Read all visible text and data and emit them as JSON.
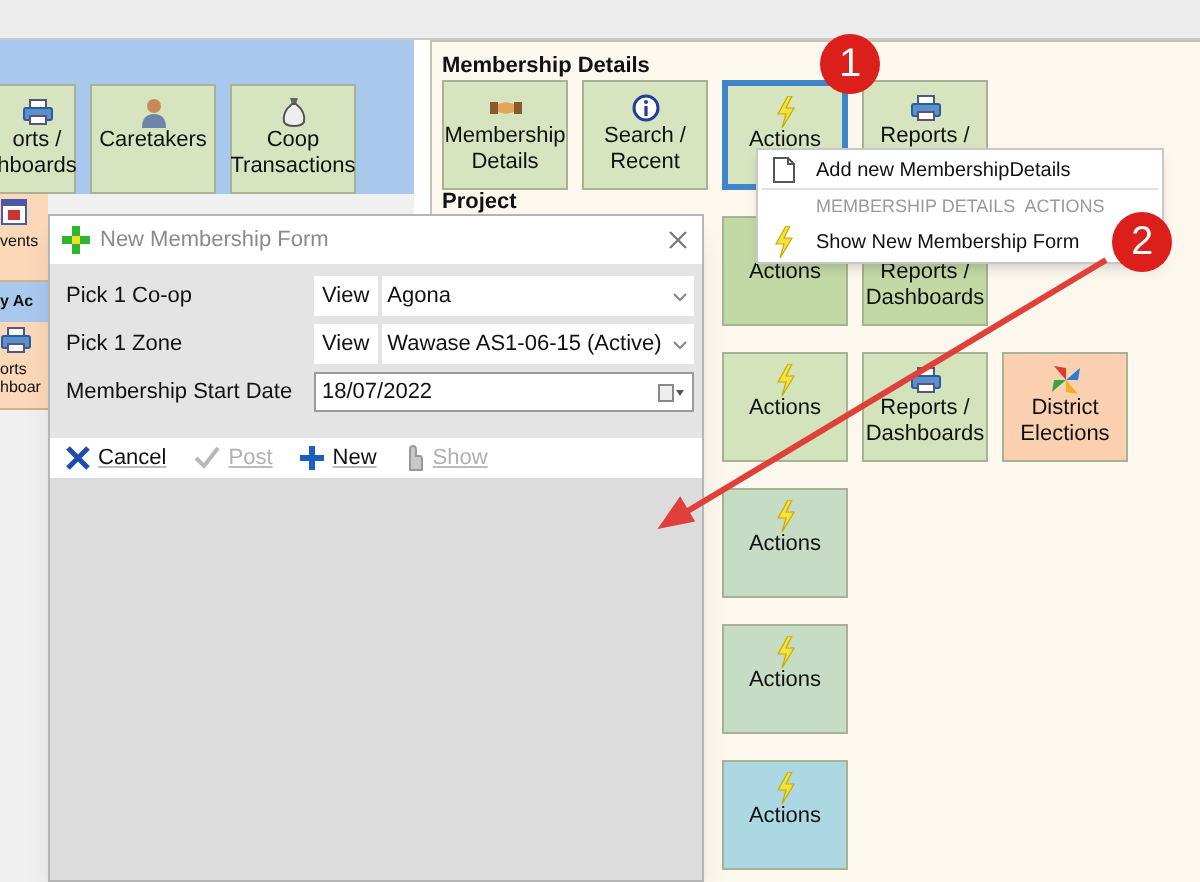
{
  "left_panel": {
    "tiles": [
      {
        "label": "orts /\nhboards",
        "kind": "printer",
        "color": "#d6e4c0"
      },
      {
        "label": "Caretakers",
        "kind": "person",
        "color": "#d6e4c0"
      },
      {
        "label": "Coop\nTransactions",
        "kind": "moneybag",
        "color": "#d6e4c0"
      }
    ]
  },
  "left_strip": {
    "items": [
      {
        "kind": "calendar",
        "label": "vents"
      },
      {
        "kind": "heading",
        "label": "y Ac"
      },
      {
        "kind": "printer",
        "label": "orts\nhboar"
      }
    ]
  },
  "right_panel": {
    "sections": [
      {
        "title": "Membership Details",
        "tiles": [
          {
            "label": "Membership\nDetails",
            "kind": "handshake",
            "color": "#d6e4c0",
            "selected": false
          },
          {
            "label": "Search /\nRecent",
            "kind": "info",
            "color": "#d6e4c0",
            "selected": false
          },
          {
            "label": "Actions",
            "kind": "lightning",
            "color": "#d6e4c0",
            "selected": true
          },
          {
            "label": "Reports /",
            "kind": "printer",
            "color": "#d6e4c0",
            "selected": false
          }
        ]
      },
      {
        "title": "Project",
        "tiles": [
          {
            "label": "Actions",
            "kind": "plain",
            "color": "#c3d9a5",
            "selected": false
          },
          {
            "label": "Reports /\nDashboards",
            "kind": "plain",
            "color": "#c3d9a5",
            "selected": false
          }
        ]
      },
      {
        "tiles": [
          {
            "label": "Actions",
            "kind": "lightning",
            "color": "#d3e3bb",
            "selected": false
          },
          {
            "label": "Reports /\nDashboards",
            "kind": "printer",
            "color": "#d3e3bb",
            "selected": false
          },
          {
            "label": "District\nElections",
            "kind": "pinwheel",
            "color": "#fbd0b0",
            "selected": false
          }
        ]
      },
      {
        "tiles": [
          {
            "label": "Actions",
            "kind": "lightning",
            "color": "#c6dcc4",
            "selected": false
          }
        ]
      },
      {
        "tiles": [
          {
            "label": "Actions",
            "kind": "lightning",
            "color": "#c6dcc4",
            "selected": false
          }
        ]
      },
      {
        "tiles": [
          {
            "label": "Actions",
            "kind": "lightning",
            "color": "#acd8e4",
            "selected": false
          }
        ]
      }
    ]
  },
  "dialog": {
    "title": "New Membership Form",
    "fields": [
      {
        "kind": "combo",
        "label": "Pick 1 Co-op",
        "button": "View",
        "value": "Agona"
      },
      {
        "kind": "combo",
        "label": "Pick 1 Zone",
        "button": "View",
        "value": "Wawase AS1-06-15 (Active)"
      },
      {
        "kind": "date",
        "label": "Membership Start Date",
        "value": "18/07/2022"
      }
    ],
    "toolbar": [
      {
        "label": "Cancel",
        "kind": "cross",
        "disabled": false
      },
      {
        "label": "Post",
        "kind": "check",
        "disabled": true
      },
      {
        "label": "New",
        "kind": "plus",
        "disabled": false
      },
      {
        "label": "Show",
        "kind": "hand",
        "disabled": true
      }
    ]
  },
  "context_menu": {
    "items": [
      {
        "kind": "document",
        "label": "Add new MembershipDetails"
      },
      {
        "kind": "header",
        "label": "MEMBERSHIP DETAILS  ACTIONS"
      },
      {
        "kind": "lightning",
        "label": "Show New Membership Form"
      }
    ]
  },
  "callouts": [
    {
      "label": "1"
    },
    {
      "label": "2"
    }
  ]
}
